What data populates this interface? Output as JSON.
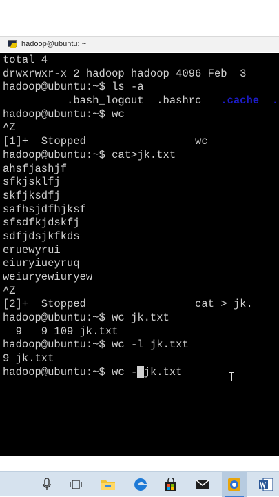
{
  "window": {
    "title": "hadoop@ubuntu: ~"
  },
  "terminal": {
    "lines": [
      "total 4",
      "drwxrwxr-x 2 hadoop hadoop 4096 Feb  3",
      "hadoop@ubuntu:~$ ls -a",
      "",
      "hadoop@ubuntu:~$ wc",
      "^Z",
      "[1]+  Stopped                 wc",
      "hadoop@ubuntu:~$ cat>jk.txt",
      "ahsfjashjf",
      "sfkjsklfj",
      "skfjksdfj",
      "safhsjdfhjksf",
      "sfsdfkjdskfj",
      "sdfjdsjkfkds",
      "eruewyrui",
      "eiuryiueyruq",
      "weiuryewiuryew",
      "^Z",
      "[2]+  Stopped                 cat > jk.",
      "hadoop@ubuntu:~$ wc jk.txt",
      "  9   9 109 jk.txt",
      "hadoop@ubuntu:~$ wc -l jk.txt",
      "9 jk.txt"
    ],
    "ls_row": {
      "indent": "          ",
      "f1": ".bash_logout",
      "sep1": "  ",
      "f2": ".bashrc",
      "sep2": "   ",
      "d1": ".cache",
      "sep3": "  ",
      "d2": ".l"
    },
    "input": {
      "prompt": "hadoop@ubuntu:~$ wc -",
      "cursor_char": " ",
      "after": "jk.txt"
    }
  },
  "colors": {
    "terminal_bg": "#000000",
    "text": "#d0d0d0",
    "directory": "#1c1cc7",
    "taskbar": "#d6e2ee"
  },
  "taskbar": {
    "icons": [
      "microphone-icon",
      "task-view-icon",
      "file-explorer-icon",
      "edge-icon",
      "store-icon",
      "mail-icon",
      "outlook-icon",
      "word-icon"
    ]
  }
}
